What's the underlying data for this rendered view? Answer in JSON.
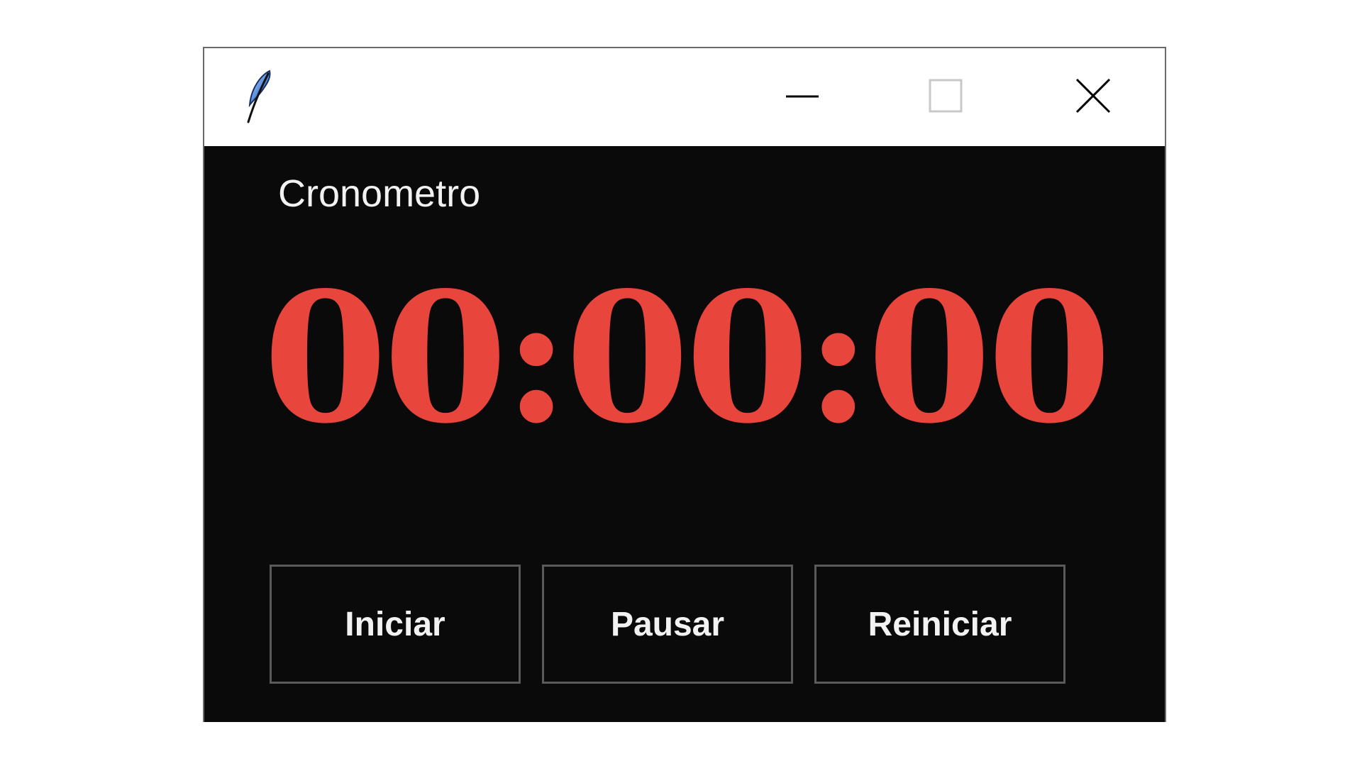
{
  "window": {
    "controls": {
      "minimize_icon": "minimize-icon",
      "maximize_icon": "maximize-icon",
      "close_icon": "close-icon"
    },
    "app_icon": "feather-icon"
  },
  "main": {
    "title": "Cronometro",
    "time": "00:00:00"
  },
  "buttons": {
    "start_label": "Iniciar",
    "pause_label": "Pausar",
    "reset_label": "Reiniciar"
  },
  "colors": {
    "background": "#0a0a0a",
    "time_text": "#e8453c",
    "label_text": "#f2f2f2",
    "button_border": "#5a5a5a",
    "titlebar": "#ffffff"
  }
}
